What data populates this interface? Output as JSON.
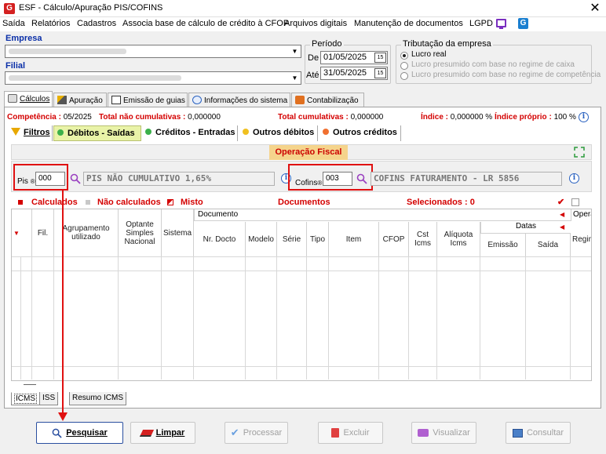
{
  "window": {
    "title": "ESF - Cálculo/Apuração PIS/COFINS",
    "logo_letter": "G",
    "close_glyph": "✕"
  },
  "menu": [
    "Saída",
    "Relatórios",
    "Cadastros",
    "Associa base de cálculo de crédito à CFOP",
    "Arquivos digitais",
    "Manutenção de documentos",
    "LGPD"
  ],
  "empresa": {
    "label": "Empresa"
  },
  "filial": {
    "label": "Filial"
  },
  "periodo": {
    "title": "Período",
    "de_label": "De",
    "de_value": "01/05/2025",
    "ate_label": "Até",
    "ate_value": "31/05/2025",
    "cal_glyph": "15"
  },
  "tributacao": {
    "title": "Tributação da empresa",
    "options": [
      "Lucro real",
      "Lucro presumido com base no regime de caixa",
      "Lucro presumido com base no regime de competência"
    ]
  },
  "tabs": [
    "Cálculos",
    "Apuração",
    "Emissão de guias",
    "Informações do sistema",
    "Contabilização"
  ],
  "status": {
    "competencia_label": "Competência :",
    "competencia_value": "05/2025",
    "total_nao_cum_label": "Total não cumulativas :",
    "total_nao_cum_value": "0,000000",
    "total_cum_label": "Total cumulativas :",
    "total_cum_value": "0,000000",
    "indice_label": "Índice :",
    "indice_value": "0,000000 %",
    "indice_proprio_label": "Índice próprio :",
    "indice_proprio_value": "100 %"
  },
  "subtabs": [
    "Filtros",
    "Débitos - Saídas",
    "Créditos - Entradas",
    "Outros débitos",
    "Outros créditos"
  ],
  "operacao_fiscal": {
    "label": "Operação Fiscal"
  },
  "pis": {
    "label": "Pis",
    "marker": "®",
    "code": "000",
    "description": "PIS NÃO CUMULATIVO 1,65%"
  },
  "cofins": {
    "label": "Cofins",
    "marker": "®",
    "code": "003",
    "description": "COFINS FATURAMENTO - LR 5856"
  },
  "legend": {
    "calculados": "Calculados",
    "nao_calculados": "Não calculados",
    "misto": "Misto",
    "documentos": "Documentos",
    "selecionados": "Selecionados : 0"
  },
  "table": {
    "group_documento": "Documento",
    "group_datas": "Datas",
    "group_operacao": "Opera",
    "headers": [
      "Fil.",
      "Agrupamento utilizado",
      "Optante Simples Nacional",
      "Sistema",
      "Nr. Docto",
      "Modelo",
      "Série",
      "Tipo",
      "Item",
      "CFOP",
      "Cst Icms",
      "Alíquota Icms",
      "Emissão",
      "Saída",
      "Regim"
    ]
  },
  "bottom_tabs": [
    "ICMS",
    "ISS",
    "Resumo ICMS"
  ],
  "buttons": {
    "pesquisar": "Pesquisar",
    "limpar": "Limpar",
    "processar": "Processar",
    "excluir": "Excluir",
    "visualizar": "Visualizar",
    "consultar": "Consultar"
  },
  "colors": {
    "accent_red": "#d40000",
    "label_blue": "#0a2fa8",
    "highlight_box": "#e01010",
    "operacao_bg": "#f5d48c"
  }
}
